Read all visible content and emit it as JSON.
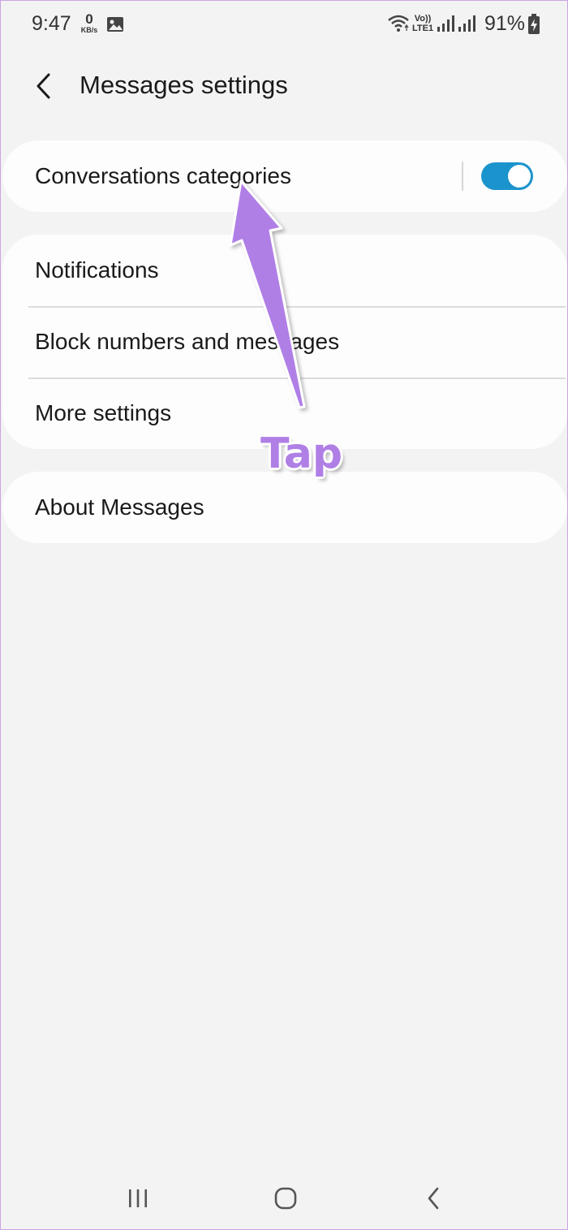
{
  "status_bar": {
    "time": "9:47",
    "speed_value": "0",
    "speed_unit": "KB/s",
    "volte_top": "Vo))",
    "volte_bottom": "LTE1",
    "battery": "91%"
  },
  "header": {
    "title": "Messages settings",
    "back_icon": "chevron-left-icon"
  },
  "settings": {
    "conversations_categories": {
      "label": "Conversations categories",
      "toggle_on": true,
      "toggle_color": "#1b93cc"
    },
    "group": [
      {
        "label": "Notifications"
      },
      {
        "label": "Block numbers and messages"
      },
      {
        "label": "More settings"
      }
    ],
    "about": {
      "label": "About Messages"
    }
  },
  "annotation": {
    "label": "Tap",
    "color": "#b07fe6"
  },
  "nav_bar": {
    "recents_icon": "recents-icon",
    "home_icon": "home-icon",
    "back_icon": "back-icon"
  }
}
